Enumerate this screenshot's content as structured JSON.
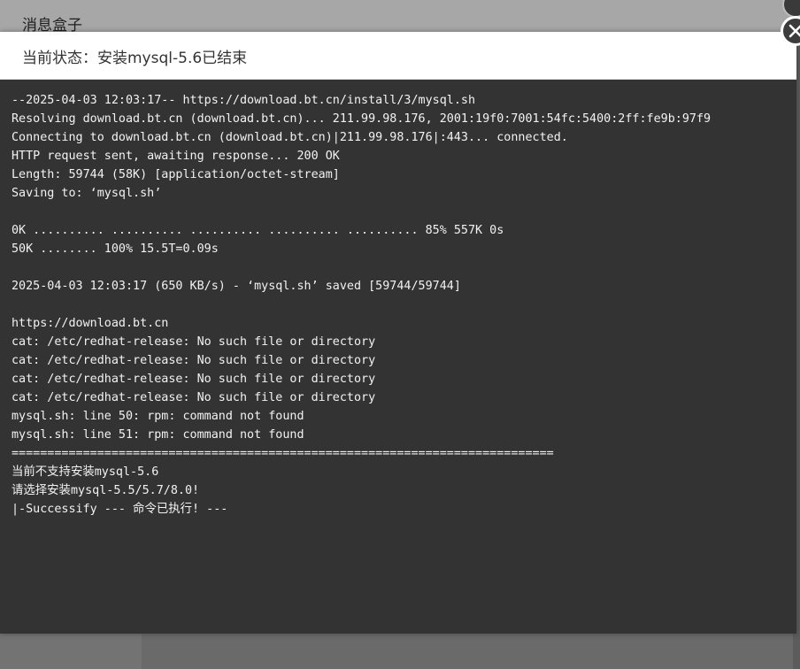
{
  "background": {
    "title": "消息盒子"
  },
  "dialog": {
    "title_label": "当前状态：",
    "title_value": "安装mysql-5.6已结束",
    "close_icon": "close-icon"
  },
  "terminal": {
    "lines": [
      "--2025-04-03 12:03:17-- https://download.bt.cn/install/3/mysql.sh",
      "Resolving download.bt.cn (download.bt.cn)... 211.99.98.176, 2001:19f0:7001:54fc:5400:2ff:fe9b:97f9",
      "Connecting to download.bt.cn (download.bt.cn)|211.99.98.176|:443... connected.",
      "HTTP request sent, awaiting response... 200 OK",
      "Length: 59744 (58K) [application/octet-stream]",
      "Saving to: ‘mysql.sh’",
      "",
      "0K .......... .......... .......... .......... .......... 85% 557K 0s",
      "50K ........ 100% 15.5T=0.09s",
      "",
      "2025-04-03 12:03:17 (650 KB/s) - ‘mysql.sh’ saved [59744/59744]",
      "",
      "https://download.bt.cn",
      "cat: /etc/redhat-release: No such file or directory",
      "cat: /etc/redhat-release: No such file or directory",
      "cat: /etc/redhat-release: No such file or directory",
      "cat: /etc/redhat-release: No such file or directory",
      "mysql.sh: line 50: rpm: command not found",
      "mysql.sh: line 51: rpm: command not found",
      "============================================================================",
      "当前不支持安装mysql-5.6",
      "请选择安装mysql-5.5/5.7/8.0!",
      "|-Successify --- 命令已执行! ---"
    ]
  },
  "colors": {
    "terminal_bg": "#333333",
    "terminal_text": "#f2f2f2",
    "header_bg": "#ffffff",
    "close_bg": "#3c3c3c"
  }
}
